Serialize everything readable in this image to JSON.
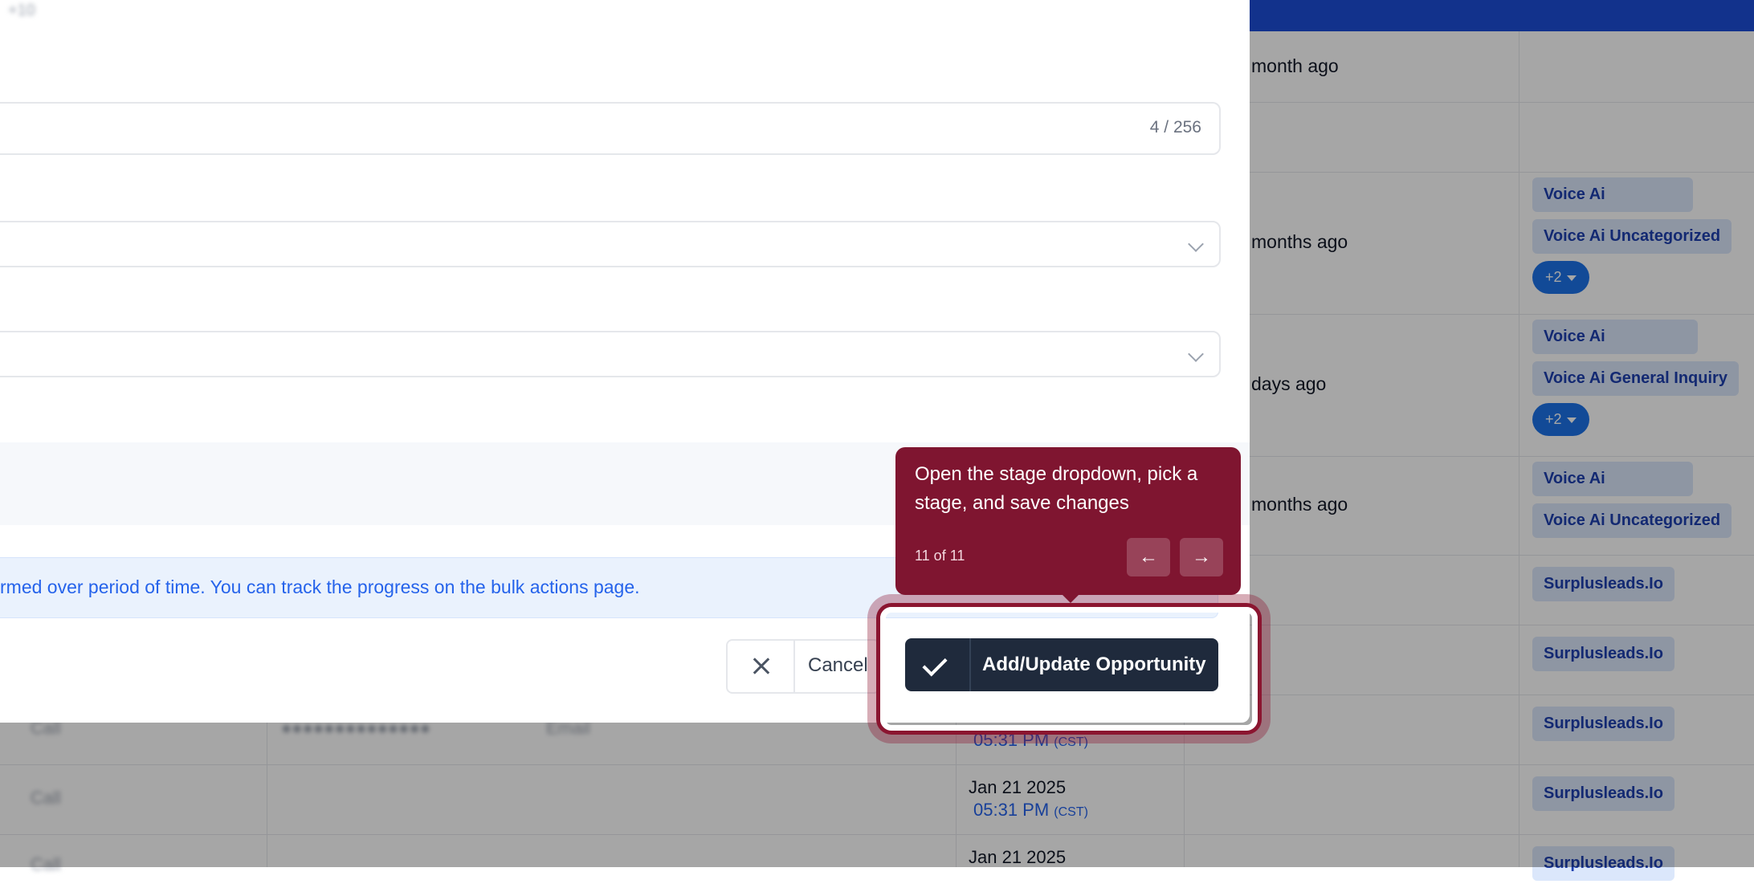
{
  "background_table": {
    "rows": [
      {
        "relative_time": "month ago",
        "tags": [],
        "more": ""
      },
      {
        "relative_time": "",
        "tags": [],
        "more": ""
      },
      {
        "relative_time": "months ago",
        "tags": [
          "Voice Ai",
          "Voice Ai Uncategorized"
        ],
        "more": "+2"
      },
      {
        "relative_time": "days ago",
        "tags": [
          "Voice Ai",
          "Voice Ai General Inquiry"
        ],
        "more": "+2"
      },
      {
        "relative_time": "months ago",
        "tags": [
          "Voice Ai",
          "Voice Ai Uncategorized"
        ],
        "more": ""
      },
      {
        "relative_time": "",
        "tags": [
          "Surplusleads.Io"
        ],
        "more": ""
      },
      {
        "relative_time": "",
        "tags": [
          "Surplusleads.Io"
        ],
        "more": ""
      },
      {
        "date": "",
        "time": "05:31 PM",
        "tz": "(CST)",
        "tags": [
          "Surplusleads.Io"
        ]
      },
      {
        "date": "Jan 21 2025",
        "time": "05:31 PM",
        "tz": "(CST)",
        "tags": [
          "Surplusleads.Io"
        ]
      },
      {
        "date": "Jan 21 2025",
        "time": "",
        "tz": "",
        "tags": [
          "Surplusleads.Io"
        ]
      }
    ],
    "blurred": {
      "call_1": "Call",
      "email_1": "Email",
      "call_2": "Call",
      "call_3": "Call",
      "corner": "+10"
    }
  },
  "modal": {
    "name_field": {
      "counter": "4 / 256"
    },
    "info_message": "rmed over period of time. You can track the progress on the bulk actions page.",
    "cancel_label": "Cancel",
    "submit_label": "Add/Update Opportunity"
  },
  "tooltip": {
    "message": "Open the stage dropdown, pick a stage, and save changes",
    "step": "11 of 11",
    "prev_icon": "arrow-left-icon",
    "next_icon": "arrow-right-icon"
  },
  "colors": {
    "tooltip_bg": "#7f1530",
    "primary_button": "#1f2a3c",
    "topbar": "#1d4ed8",
    "tag_bg": "#dbe7fb",
    "tag_text": "#1e40af",
    "info_text": "#2563eb"
  }
}
